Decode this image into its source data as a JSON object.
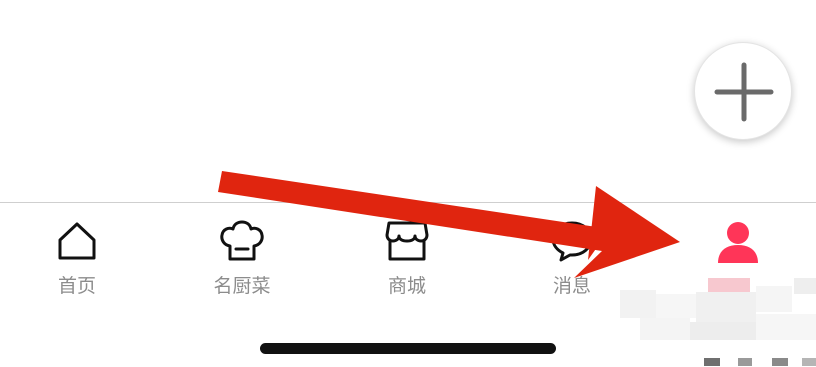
{
  "fab": {
    "icon": "plus-icon"
  },
  "tabs": [
    {
      "label": "首页",
      "icon": "home-icon",
      "active": false
    },
    {
      "label": "名厨菜",
      "icon": "chef-hat-icon",
      "active": false
    },
    {
      "label": "商城",
      "icon": "shop-icon",
      "active": false
    },
    {
      "label": "消息",
      "icon": "chat-bubble-icon",
      "active": false
    },
    {
      "label": "",
      "icon": "user-icon",
      "active": true
    }
  ],
  "colors": {
    "active": "#ff3558",
    "inactive": "#8c8c8c",
    "annotation_arrow": "#e0250f"
  }
}
